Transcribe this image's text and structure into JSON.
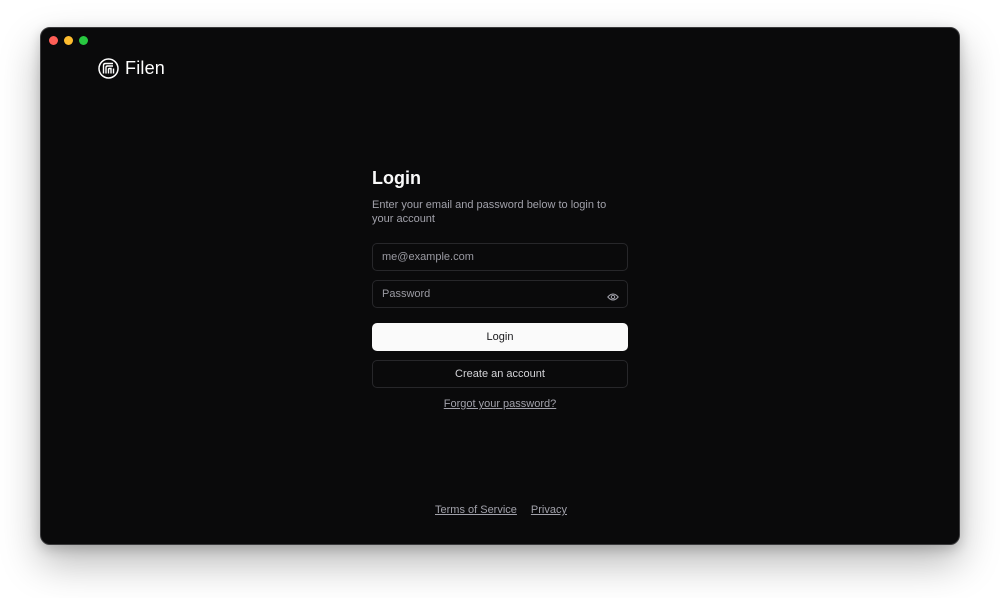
{
  "app": {
    "brand_name": "Filen",
    "logo_icon": "filen-logo-icon"
  },
  "window_controls": {
    "close_color": "#ff5f57",
    "minimize_color": "#febc2e",
    "maximize_color": "#28c840"
  },
  "login": {
    "title": "Login",
    "subtitle": "Enter your email and password below to login to your account",
    "email": {
      "placeholder": "me@example.com",
      "value": ""
    },
    "password": {
      "placeholder": "Password",
      "value": "",
      "toggle_icon": "eye-icon"
    },
    "login_button": "Login",
    "create_account_button": "Create an account",
    "forgot_password_link": "Forgot your password?"
  },
  "footer": {
    "terms_link": "Terms of Service",
    "privacy_link": "Privacy"
  },
  "colors": {
    "background": "#0a0a0b",
    "border": "#27272a",
    "primary_button": "#fafafa",
    "muted_text": "#a1a1aa"
  }
}
